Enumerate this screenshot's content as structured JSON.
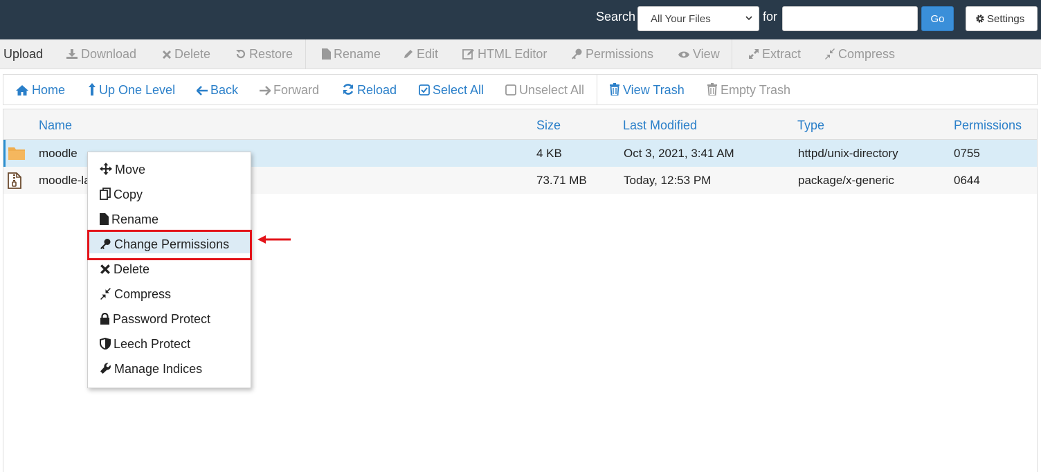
{
  "search": {
    "label": "Search",
    "scope_value": "All Your Files",
    "for_label": "for",
    "query_value": "",
    "go_label": "Go",
    "settings_label": "Settings"
  },
  "toolbar": {
    "upload": "Upload",
    "download": "Download",
    "delete": "Delete",
    "restore": "Restore",
    "rename": "Rename",
    "edit": "Edit",
    "html_editor": "HTML Editor",
    "permissions": "Permissions",
    "view": "View",
    "extract": "Extract",
    "compress": "Compress"
  },
  "nav": {
    "home": "Home",
    "up_one_level": "Up One Level",
    "back": "Back",
    "forward": "Forward",
    "reload": "Reload",
    "select_all": "Select All",
    "unselect_all": "Unselect All",
    "view_trash": "View Trash",
    "empty_trash": "Empty Trash"
  },
  "table": {
    "headers": [
      "Name",
      "Size",
      "Last Modified",
      "Type",
      "Permissions"
    ],
    "rows": [
      {
        "name": "moodle",
        "size": "4 KB",
        "modified": "Oct 3, 2021, 3:41 AM",
        "type": "httpd/unix-directory",
        "perms": "0755",
        "icon": "folder-icon"
      },
      {
        "name": "moodle-la",
        "size": "73.71 MB",
        "modified": "Today, 12:53 PM",
        "type": "package/x-generic",
        "perms": "0644",
        "icon": "archive-file-icon"
      }
    ]
  },
  "context_menu": {
    "items": [
      {
        "label": "Move",
        "icon": "move-icon"
      },
      {
        "label": "Copy",
        "icon": "copy-icon"
      },
      {
        "label": "Rename",
        "icon": "file-icon"
      },
      {
        "label": "Change Permissions",
        "icon": "key-icon"
      },
      {
        "label": "Delete",
        "icon": "times-icon"
      },
      {
        "label": "Compress",
        "icon": "compress-icon"
      },
      {
        "label": "Password Protect",
        "icon": "lock-icon"
      },
      {
        "label": "Leech Protect",
        "icon": "shield-icon"
      },
      {
        "label": "Manage Indices",
        "icon": "wrench-icon"
      }
    ]
  },
  "colors": {
    "topbar": "#293a4a",
    "accent": "#2a7fc9",
    "selected_row": "#d9ecf7",
    "highlight_border": "#e3141a"
  }
}
